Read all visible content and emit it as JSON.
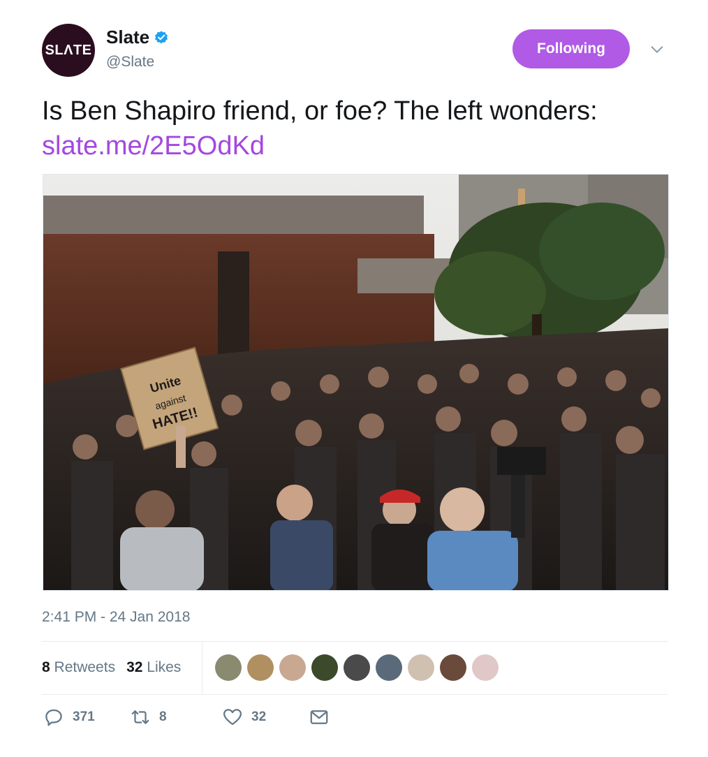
{
  "author": {
    "logo_text": "SLΛTE",
    "name": "Slate",
    "handle": "@Slate",
    "verified": true
  },
  "follow_button": {
    "label": "Following",
    "color": "#b05ae6"
  },
  "tweet": {
    "text": "Is Ben Shapiro friend, or foe? The left wonders: ",
    "link": "slate.me/2E5OdKd",
    "link_color": "#a447e0",
    "sign_text": "Unite against HATE!!"
  },
  "timestamp": "2:41 PM - 24 Jan 2018",
  "stats": {
    "retweets_count": "8",
    "retweets_label": "Retweets",
    "likes_count": "32",
    "likes_label": "Likes"
  },
  "likers": [
    {
      "icon": "avatar-1"
    },
    {
      "icon": "avatar-2"
    },
    {
      "icon": "avatar-3"
    },
    {
      "icon": "avatar-4"
    },
    {
      "icon": "avatar-5"
    },
    {
      "icon": "avatar-6"
    },
    {
      "icon": "avatar-7"
    },
    {
      "icon": "avatar-8"
    },
    {
      "icon": "avatar-9"
    }
  ],
  "actions": {
    "reply_count": "371",
    "retweet_count": "8",
    "like_count": "32",
    "reply_icon": "reply-icon",
    "retweet_icon": "retweet-icon",
    "like_icon": "heart-icon",
    "message_icon": "envelope-icon"
  }
}
